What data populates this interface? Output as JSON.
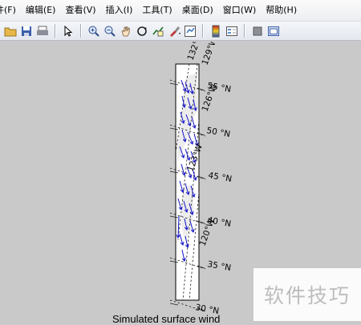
{
  "menu": [
    "件(F)",
    "编辑(E)",
    "查看(V)",
    "插入(I)",
    "工具(T)",
    "桌面(D)",
    "窗口(W)",
    "帮助(H)"
  ],
  "toolbar": {
    "icons": [
      "folder-open-icon",
      "save-icon",
      "print-icon",
      "pointer-icon",
      "zoom-in-icon",
      "zoom-out-icon",
      "pan-hand-icon",
      "rotate-3d-icon",
      "data-cursor-icon",
      "brush-icon",
      "link-plot-icon",
      "colorbar-icon",
      "legend-icon",
      "hide-plot-tools-icon",
      "show-plot-tools-icon"
    ]
  },
  "map": {
    "lat_labels": [
      "55 °N",
      "50 °N",
      "45 °N",
      "40 °N",
      "35 °N",
      "30 °N"
    ],
    "lon_labels": [
      "132°",
      "129°W",
      "126°W",
      "123°W",
      "120°W"
    ],
    "vector_color": "#1414c8",
    "frame_color": "#000000"
  },
  "title": "Simulated surface wind",
  "watermark": "软件技巧"
}
